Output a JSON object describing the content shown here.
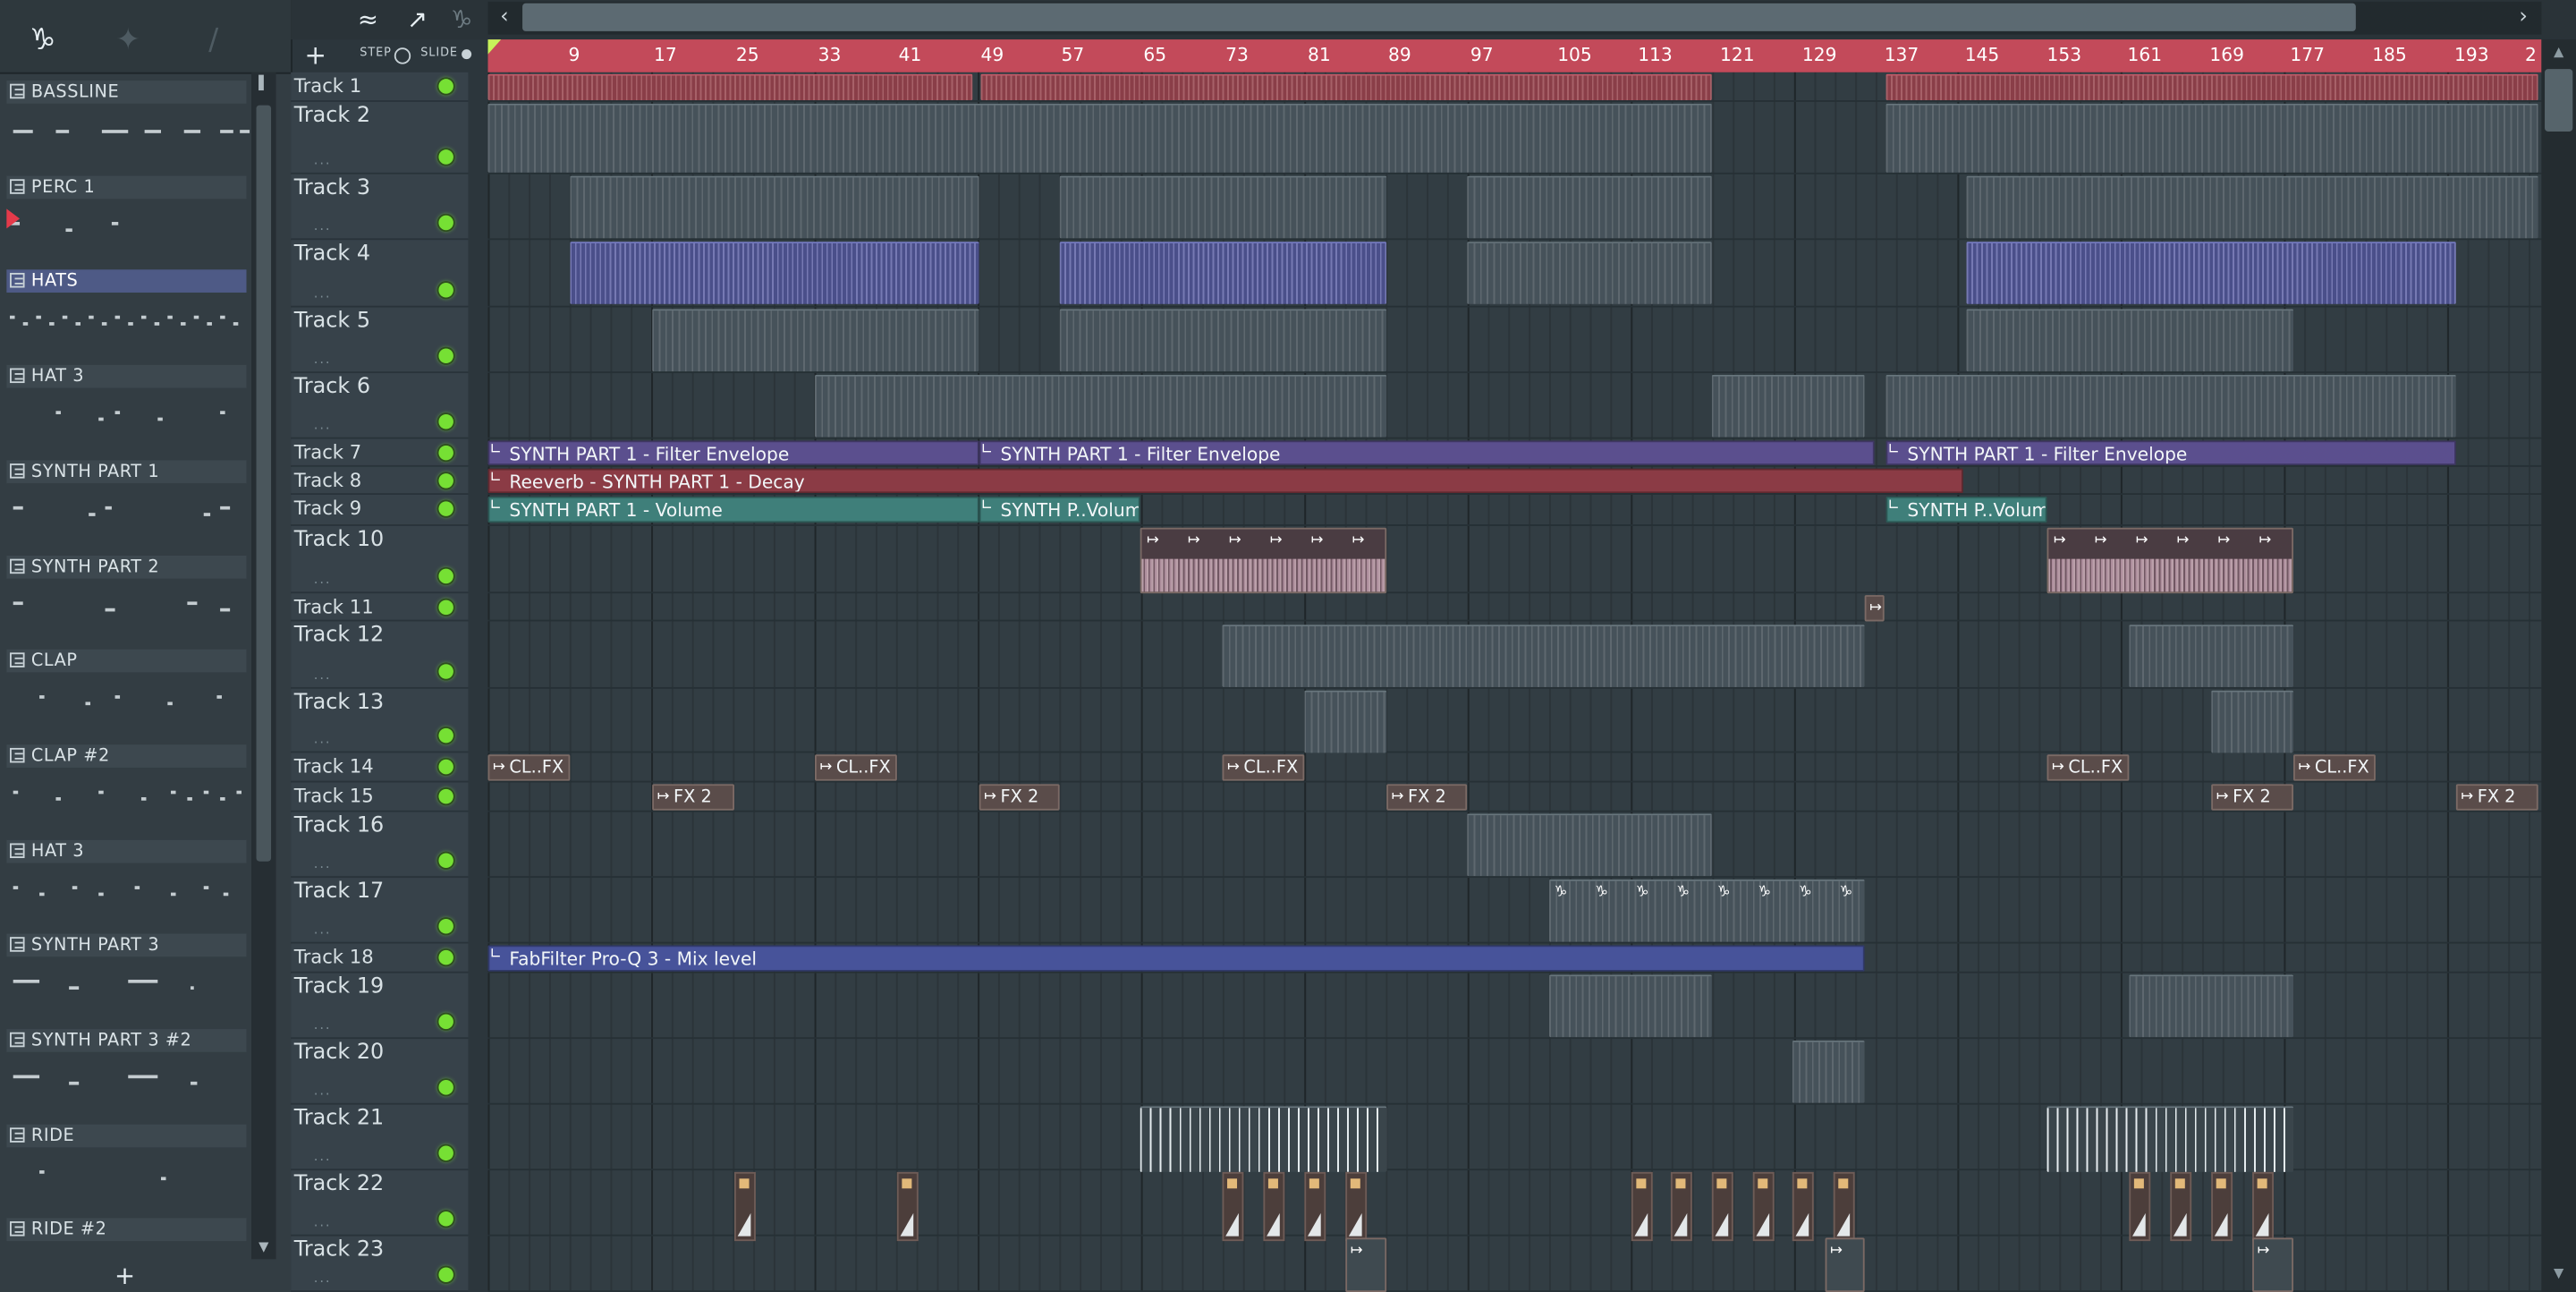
{
  "colors": {
    "ruler": "#c34a5a",
    "selected_pattern": "#4e5a86",
    "led": "#76e034"
  },
  "toolbar": {
    "step_label": "STEP",
    "slide_label": "SLIDE",
    "add_track": "+",
    "icons": [
      "piano-roll-icon",
      "waveform-icon",
      "curve-icon",
      "pattern-icon"
    ]
  },
  "picker": {
    "add_label": "+",
    "patterns": [
      {
        "name": "BASSLINE"
      },
      {
        "name": "PERC 1"
      },
      {
        "name": "HATS",
        "selected": true
      },
      {
        "name": "HAT 3"
      },
      {
        "name": "SYNTH PART 1"
      },
      {
        "name": "SYNTH PART 2"
      },
      {
        "name": "CLAP"
      },
      {
        "name": "CLAP #2"
      },
      {
        "name": "HAT 3"
      },
      {
        "name": "SYNTH PART 3"
      },
      {
        "name": "SYNTH PART 3 #2"
      },
      {
        "name": "RIDE"
      },
      {
        "name": "RIDE #2"
      }
    ]
  },
  "ruler": {
    "ticks": [
      "9",
      "17",
      "25",
      "33",
      "41",
      "49",
      "57",
      "65",
      "73",
      "81",
      "89",
      "97",
      "105",
      "113",
      "121",
      "129",
      "137",
      "145",
      "153",
      "161",
      "169",
      "177",
      "185",
      "193",
      "2"
    ]
  },
  "tracks": [
    "Track 1",
    "Track 2",
    "Track 3",
    "Track 4",
    "Track 5",
    "Track 6",
    "Track 7",
    "Track 8",
    "Track 9",
    "Track 10",
    "Track 11",
    "Track 12",
    "Track 13",
    "Track 14",
    "Track 15",
    "Track 16",
    "Track 17",
    "Track 18",
    "Track 19",
    "Track 20",
    "Track 21",
    "Track 22",
    "Track 23"
  ],
  "track_dots": "...",
  "clip_labels": {
    "filter_env": "SYNTH PART 1 - Filter Envelope",
    "reverb_decay": "Reeverb - SYNTH PART 1 - Decay",
    "volume": "SYNTH PART 1 - Volume",
    "volume_short": "SYNTH P..Volume",
    "clfx": "CL..FX",
    "fx2": "FX 2",
    "proq": "FabFilter Pro-Q 3 - Mix level"
  }
}
